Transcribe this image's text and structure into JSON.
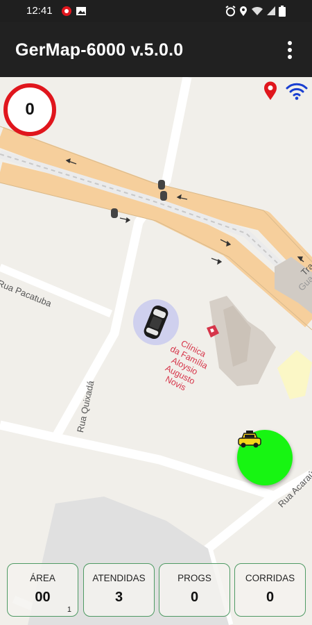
{
  "status_bar": {
    "time": "12:41",
    "left_icons": [
      "notification-icon",
      "image-icon"
    ],
    "right_icons": [
      "alarm-icon",
      "location-icon",
      "wifi-icon",
      "signal-icon",
      "battery-icon"
    ]
  },
  "app_bar": {
    "title": "GerMap-6000 v.5.0.0",
    "menu_icon": "overflow-menu-icon"
  },
  "map": {
    "speed_counter": "0",
    "indicators": [
      "location-pin-icon",
      "wifi-icon"
    ],
    "streets": {
      "rua_pacatuba": "Rua Pacatuba",
      "rua_quixada": "Rua Quixadá",
      "rua_acarau": "Rua Acaraú",
      "tra": "Tra",
      "gua": "Gua"
    },
    "clinic_lines": [
      "Clínica",
      "da Família",
      "Aloysio",
      "Augusto",
      "Novis"
    ],
    "colors": {
      "speed_ring": "#e0161d",
      "taxi_button": "#17f512",
      "car_marker_bg": "#cfd0ee",
      "clinic_label": "#d6354a",
      "road_main": "#f6cf9c"
    }
  },
  "stats": [
    {
      "label": "ÁREA",
      "value": "00",
      "sub": "1"
    },
    {
      "label": "ATENDIDAS",
      "value": "3"
    },
    {
      "label": "PROGS",
      "value": "0"
    },
    {
      "label": "CORRIDAS",
      "value": "0"
    }
  ]
}
